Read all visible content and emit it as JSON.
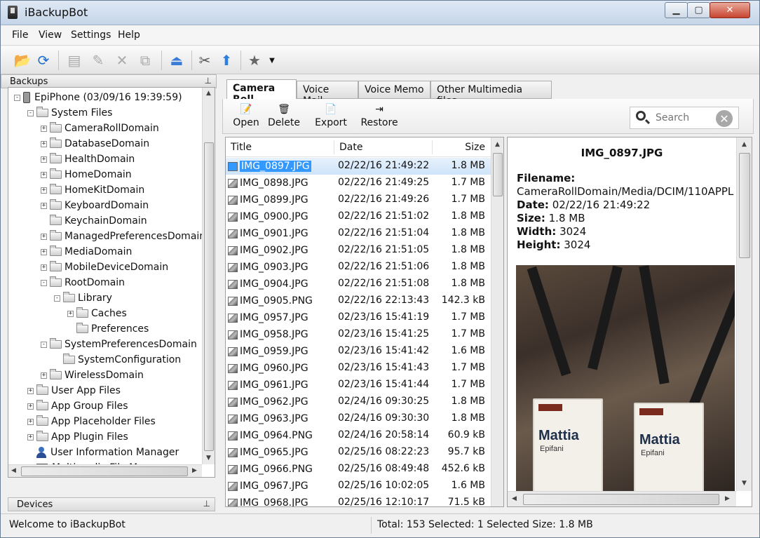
{
  "window": {
    "title": "iBackupBot"
  },
  "menu": [
    "File",
    "View",
    "Settings",
    "Help"
  ],
  "toolbar_icons": [
    "open-backup-icon",
    "refresh-icon",
    "copy-icon",
    "clean-icon",
    "delete-icon",
    "export-icon",
    "eject-icon",
    "tools-icon",
    "upload-icon",
    "favorites-icon",
    "dropdown-arrow-icon"
  ],
  "backups_panel": {
    "title": "Backups",
    "pin": "📌"
  },
  "devices_panel": {
    "title": "Devices",
    "pin": "📌"
  },
  "tree": [
    {
      "label": "EpiPhone (03/09/16 19:39:59)",
      "level": 0,
      "icon": "phone",
      "exp": "-"
    },
    {
      "label": "System Files",
      "level": 1,
      "icon": "folder",
      "exp": "-"
    },
    {
      "label": "CameraRollDomain",
      "level": 2,
      "icon": "folder",
      "exp": "+"
    },
    {
      "label": "DatabaseDomain",
      "level": 2,
      "icon": "folder",
      "exp": "+"
    },
    {
      "label": "HealthDomain",
      "level": 2,
      "icon": "folder",
      "exp": "+"
    },
    {
      "label": "HomeDomain",
      "level": 2,
      "icon": "folder",
      "exp": "+"
    },
    {
      "label": "HomeKitDomain",
      "level": 2,
      "icon": "folder",
      "exp": "+"
    },
    {
      "label": "KeyboardDomain",
      "level": 2,
      "icon": "folder",
      "exp": "+"
    },
    {
      "label": "KeychainDomain",
      "level": 2,
      "icon": "folder",
      "exp": ""
    },
    {
      "label": "ManagedPreferencesDomain",
      "level": 2,
      "icon": "folder",
      "exp": "+"
    },
    {
      "label": "MediaDomain",
      "level": 2,
      "icon": "folder",
      "exp": "+"
    },
    {
      "label": "MobileDeviceDomain",
      "level": 2,
      "icon": "folder",
      "exp": "+"
    },
    {
      "label": "RootDomain",
      "level": 2,
      "icon": "folder",
      "exp": "-"
    },
    {
      "label": "Library",
      "level": 3,
      "icon": "folder",
      "exp": "-"
    },
    {
      "label": "Caches",
      "level": 4,
      "icon": "folder",
      "exp": "+"
    },
    {
      "label": "Preferences",
      "level": 4,
      "icon": "folder",
      "exp": ""
    },
    {
      "label": "SystemPreferencesDomain",
      "level": 2,
      "icon": "folder",
      "exp": "-"
    },
    {
      "label": "SystemConfiguration",
      "level": 3,
      "icon": "folder",
      "exp": ""
    },
    {
      "label": "WirelessDomain",
      "level": 2,
      "icon": "folder",
      "exp": "+"
    },
    {
      "label": "User App Files",
      "level": 1,
      "icon": "folder",
      "exp": "+"
    },
    {
      "label": "App Group Files",
      "level": 1,
      "icon": "folder",
      "exp": "+"
    },
    {
      "label": "App Placeholder Files",
      "level": 1,
      "icon": "folder",
      "exp": "+"
    },
    {
      "label": "App Plugin Files",
      "level": 1,
      "icon": "folder",
      "exp": "+"
    },
    {
      "label": "User Information Manager",
      "level": 1,
      "icon": "user",
      "exp": ""
    },
    {
      "label": "Multimedia File Manager",
      "level": 1,
      "icon": "multimedia",
      "exp": ""
    }
  ],
  "tabs": [
    "Camera Roll",
    "Voice Mail",
    "Voice Memo",
    "Other Multimedia files"
  ],
  "actions": {
    "open": "Open",
    "delete": "Delete",
    "export": "Export",
    "restore": "Restore"
  },
  "search": {
    "placeholder": "Search"
  },
  "file_list": {
    "headers": {
      "title": "Title",
      "date": "Date",
      "size": "Size"
    },
    "rows": [
      [
        "IMG_0897.JPG",
        "02/22/16 21:49:22",
        "1.8 MB"
      ],
      [
        "IMG_0898.JPG",
        "02/22/16 21:49:25",
        "1.7 MB"
      ],
      [
        "IMG_0899.JPG",
        "02/22/16 21:49:26",
        "1.7 MB"
      ],
      [
        "IMG_0900.JPG",
        "02/22/16 21:51:02",
        "1.8 MB"
      ],
      [
        "IMG_0901.JPG",
        "02/22/16 21:51:04",
        "1.8 MB"
      ],
      [
        "IMG_0902.JPG",
        "02/22/16 21:51:05",
        "1.8 MB"
      ],
      [
        "IMG_0903.JPG",
        "02/22/16 21:51:06",
        "1.8 MB"
      ],
      [
        "IMG_0904.JPG",
        "02/22/16 21:51:08",
        "1.8 MB"
      ],
      [
        "IMG_0905.PNG",
        "02/22/16 22:13:43",
        "142.3 kB"
      ],
      [
        "IMG_0957.JPG",
        "02/23/16 15:41:19",
        "1.7 MB"
      ],
      [
        "IMG_0958.JPG",
        "02/23/16 15:41:25",
        "1.7 MB"
      ],
      [
        "IMG_0959.JPG",
        "02/23/16 15:41:42",
        "1.6 MB"
      ],
      [
        "IMG_0960.JPG",
        "02/23/16 15:41:43",
        "1.7 MB"
      ],
      [
        "IMG_0961.JPG",
        "02/23/16 15:41:44",
        "1.7 MB"
      ],
      [
        "IMG_0962.JPG",
        "02/24/16 09:30:25",
        "1.8 MB"
      ],
      [
        "IMG_0963.JPG",
        "02/24/16 09:30:30",
        "1.8 MB"
      ],
      [
        "IMG_0964.PNG",
        "02/24/16 20:58:14",
        "60.9 kB"
      ],
      [
        "IMG_0965.JPG",
        "02/25/16 08:22:23",
        "95.7 kB"
      ],
      [
        "IMG_0966.PNG",
        "02/25/16 08:49:48",
        "452.6 kB"
      ],
      [
        "IMG_0967.JPG",
        "02/25/16 10:02:05",
        "1.6 MB"
      ],
      [
        "IMG_0968.JPG",
        "02/25/16 12:10:17",
        "71.5 kB"
      ]
    ],
    "selected_index": 0
  },
  "preview": {
    "title": "IMG_0897.JPG",
    "filename_label": "Filename:",
    "filename_value": "CameraRollDomain/Media/DCIM/110APPL",
    "date_label": "Date:",
    "date_value": "02/22/16 21:49:22",
    "size_label": "Size:",
    "size_value": "1.8 MB",
    "width_label": "Width:",
    "width_value": "3024",
    "height_label": "Height:",
    "height_value": "3024",
    "photo": {
      "badge_name_1": "Mattia",
      "badge_name_2": "Mattia",
      "badge_surname": "Epifani"
    }
  },
  "status": {
    "left": "Welcome to iBackupBot",
    "right": "Total: 153 Selected: 1 Selected Size: 1.8 MB"
  },
  "colors": {
    "selection": "#3399ff",
    "title_bar": "#c5d5e8",
    "close_button": "#c74530"
  }
}
